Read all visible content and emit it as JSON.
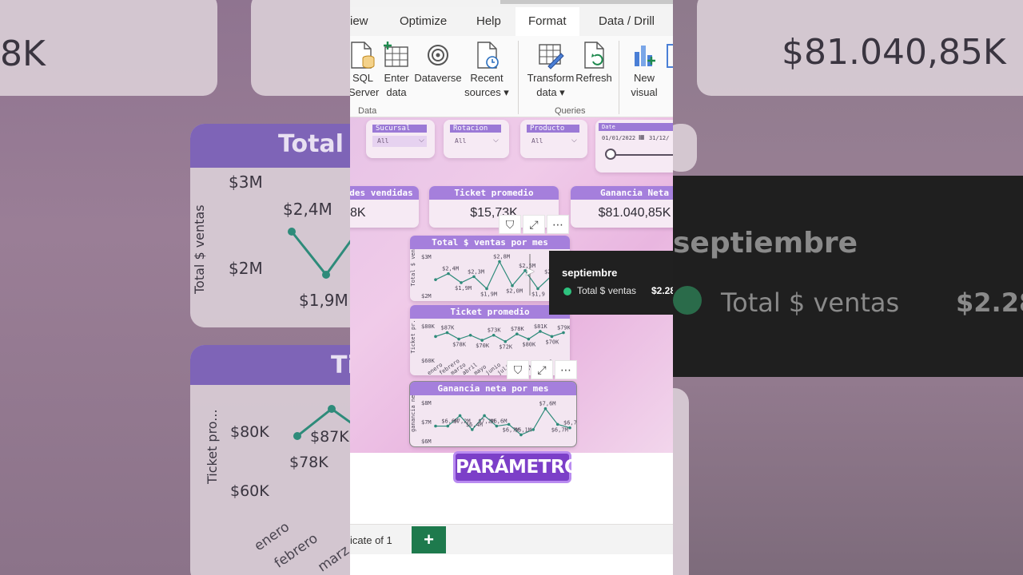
{
  "menu": {
    "tabs": [
      "View",
      "Optimize",
      "Help",
      "Format",
      "Data / Drill"
    ],
    "view_fragment": "iew",
    "active": "Format"
  },
  "ribbon": {
    "buttons": [
      {
        "id": "sql",
        "line1": "SQL",
        "line2": "Server",
        "icon": "database-icon"
      },
      {
        "id": "enter",
        "line1": "Enter",
        "line2": "data",
        "icon": "table-add-icon"
      },
      {
        "id": "dataverse",
        "line1": "Dataverse",
        "line2": "",
        "icon": "dataverse-icon"
      },
      {
        "id": "recent",
        "line1": "Recent",
        "line2": "sources ▾",
        "icon": "recent-file-icon"
      },
      {
        "id": "transform",
        "line1": "Transform",
        "line2": "data ▾",
        "icon": "transform-icon"
      },
      {
        "id": "refresh",
        "line1": "Refresh",
        "line2": "",
        "icon": "refresh-icon"
      },
      {
        "id": "newvisual",
        "line1": "New",
        "line2": "visual",
        "icon": "new-visual-icon"
      }
    ],
    "groups": {
      "data": "Data",
      "queries": "Queries"
    }
  },
  "slicers": [
    {
      "title": "Sucursal",
      "value": "All"
    },
    {
      "title": "Rotacion",
      "value": "All"
    },
    {
      "title": "Producto",
      "value": "All"
    },
    {
      "title": "Date",
      "start": "01/01/2022",
      "end": "31/12/"
    }
  ],
  "kpis": [
    {
      "title": "des vendidas",
      "value": "8K"
    },
    {
      "title": "Ticket promedio",
      "value": "$15,73K"
    },
    {
      "title": "Ganancia Neta",
      "value": "$81.040,85K"
    }
  ],
  "charts": {
    "sales": {
      "title": "Total $ ventas por mes",
      "ylabel": "Total $ ventas",
      "yticks": [
        "$3M",
        "$2M"
      ]
    },
    "ticket": {
      "title": "Ticket promedio",
      "ylabel": "Ticket pr...",
      "yticks": [
        "$80K",
        "$60K"
      ]
    },
    "profit": {
      "title": "Ganancia neta por mes",
      "ylabel": "ganancia neta",
      "yticks": [
        "$8M",
        "$7M",
        "$6M"
      ]
    }
  },
  "chart_data": [
    {
      "type": "line",
      "title": "Total $ ventas por mes",
      "ylabel": "Total $ ventas",
      "ylim": [
        1.7,
        3.0
      ],
      "x": [
        1,
        2,
        3,
        4,
        5,
        6,
        7,
        8,
        9,
        10,
        11
      ],
      "values": [
        2.2,
        2.4,
        2.1,
        2.3,
        1.9,
        2.8,
        2.0,
        2.5,
        1.9,
        2.3,
        2.4
      ],
      "labels": [
        "",
        "$2,4M",
        "$1,9M",
        "$2,3M",
        "$1,9M",
        "$2,8M",
        "$2,0M",
        "$2,5M",
        "$1,9",
        "$2,3",
        "$2"
      ]
    },
    {
      "type": "line",
      "title": "Ticket promedio",
      "ylabel": "Ticket pr...",
      "categories": [
        "enero",
        "febrero",
        "marzo",
        "abril",
        "mayo",
        "junio",
        "julio",
        "agosto",
        "sept",
        "octubre",
        "nov",
        "dic"
      ],
      "ylim": [
        58,
        85
      ],
      "values": [
        76,
        79,
        74,
        77,
        73,
        77,
        72,
        78,
        74,
        80,
        76,
        79
      ],
      "labels": [
        "",
        "$87K",
        "$78K",
        "",
        "$70K",
        "$73K",
        "$72K",
        "$78K",
        "$80K",
        "$81K",
        "$70K",
        "$79K"
      ]
    },
    {
      "type": "line",
      "title": "Ganancia neta por mes",
      "ylabel": "ganancia neta",
      "ylim": [
        5.8,
        8.0
      ],
      "x": [
        1,
        2,
        3,
        4,
        5,
        6,
        7,
        8,
        9,
        10,
        11,
        12
      ],
      "values": [
        6.6,
        6.6,
        7.2,
        6.4,
        7.2,
        6.6,
        6.7,
        6.1,
        6.4,
        7.6,
        6.7,
        6.5
      ],
      "labels": [
        "",
        "$6,6M",
        "$7,2M",
        "$6,4M",
        "$7,2M",
        "$6,6M",
        "$6,7M",
        "$6,1M",
        "",
        "$7,6M",
        "$6,7M",
        "$6,7M"
      ]
    }
  ],
  "tooltip": {
    "month": "septiembre",
    "series": "Total $ ventas",
    "value": "$2.28"
  },
  "overlay": {
    "text": "PARÁMETRO"
  },
  "footer": {
    "page_text": "icate of 1",
    "add": "+"
  },
  "background": {
    "left_top_value": "8K",
    "left_card_title": "Total",
    "left_yaxis": "Total $ ventas",
    "left_labels": [
      "$3M",
      "$2,4M",
      "$2M",
      "$1,9M"
    ],
    "left_card2_title": "Ti",
    "left_ylabel2": "Ticket pro...",
    "left_labels2": [
      "$80K",
      "$87K",
      "$78K",
      "$60K"
    ],
    "left_months": [
      "enero",
      "febrero",
      "marz"
    ],
    "right_top_value": "$81.040,85K",
    "right_month": "septiembre",
    "right_series": "Total $ ventas",
    "right_value": "$2.28"
  },
  "colors": {
    "accent": "#a57fdc",
    "line": "#2e8b7a",
    "tooltip_dot": "#2ec27e",
    "add_button": "#1e7a4d",
    "overlay": "#7c3fc8"
  }
}
